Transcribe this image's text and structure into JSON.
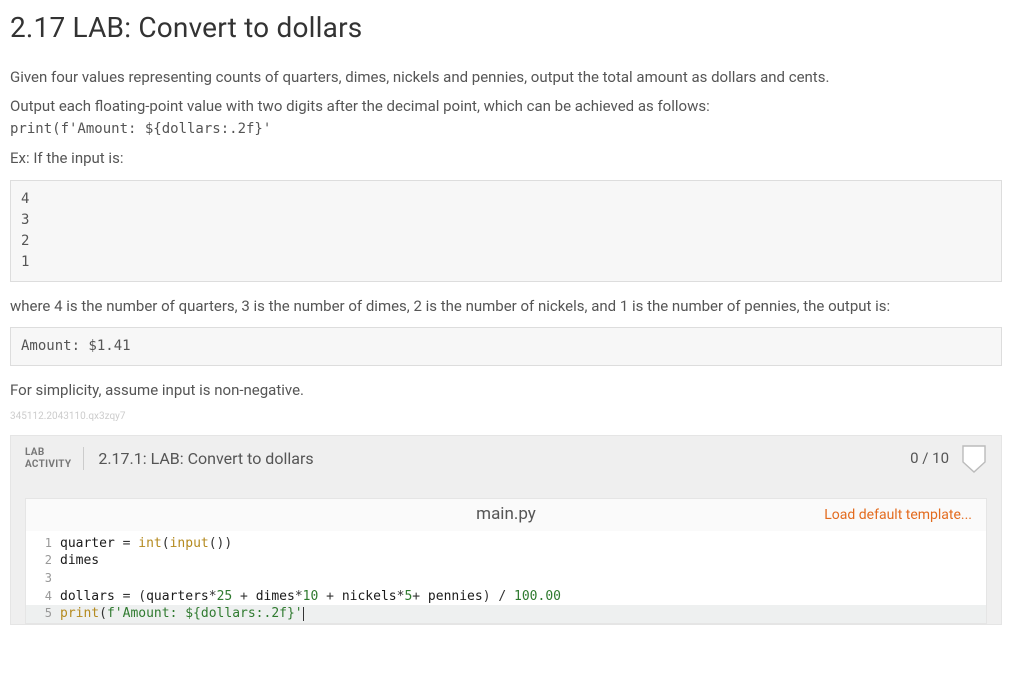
{
  "page": {
    "title": "2.17 LAB: Convert to dollars",
    "para1": "Given four values representing counts of quarters, dimes, nickels and pennies, output the total amount as dollars and cents.",
    "para2": "Output each floating-point value with two digits after the decimal point, which can be achieved as follows:",
    "code_example": "print(f'Amount: ${dollars:.2f}'",
    "ex_label": "Ex: If the input is:",
    "input_block": "4\n3\n2\n1",
    "where_text": "where 4 is the number of quarters, 3 is the number of dimes, 2 is the number of nickels, and 1 is the number of pennies, the output is:",
    "output_block": "Amount: $1.41",
    "simplicity": "For simplicity, assume input is non-negative.",
    "watermark": "345112.2043110.qx3zqy7"
  },
  "lab": {
    "badge_line1": "LAB",
    "badge_line2": "ACTIVITY",
    "title": "2.17.1: LAB: Convert to dollars",
    "score": "0 / 10"
  },
  "editor": {
    "filename": "main.py",
    "load_template": "Load default template...",
    "lines": {
      "l1": "quarter = int(input())",
      "l2": "dimes",
      "l3": "",
      "l4": "dollars = (quarters*25 + dimes*10 + nickels*5+ pennies) / 100.00",
      "l5": "print(f'Amount: ${dollars:.2f}'"
    }
  }
}
